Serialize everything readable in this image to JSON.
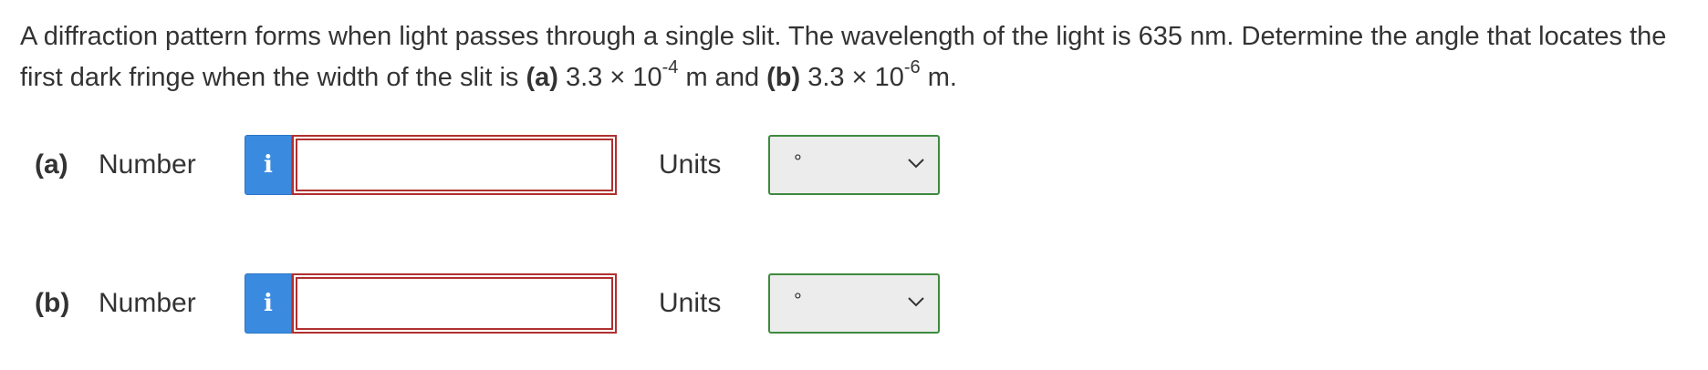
{
  "question": {
    "intro": "A diffraction pattern forms when light passes through a single slit. The wavelength of the light is 635 nm. Determine the angle that locates the first dark fringe when the width of the slit is ",
    "part_a_label": "(a)",
    "part_a_value_prefix": " 3.3 × 10",
    "part_a_exponent": "-4",
    "connector": " m and ",
    "part_b_label": "(b)",
    "part_b_value_prefix": " 3.3 × 10",
    "part_b_exponent": "-6",
    "ending": " m."
  },
  "answers": [
    {
      "part": "(a)",
      "number_label": "Number",
      "info_icon_glyph": "i",
      "input_value": "",
      "units_label": "Units",
      "units_selected": "°"
    },
    {
      "part": "(b)",
      "number_label": "Number",
      "info_icon_glyph": "i",
      "input_value": "",
      "units_label": "Units",
      "units_selected": "°"
    }
  ],
  "colors": {
    "info_button": "#3a8be0",
    "input_border_invalid": "#b03030",
    "select_border": "#3e8a3e",
    "select_background": "#ececec",
    "text": "#333333"
  }
}
